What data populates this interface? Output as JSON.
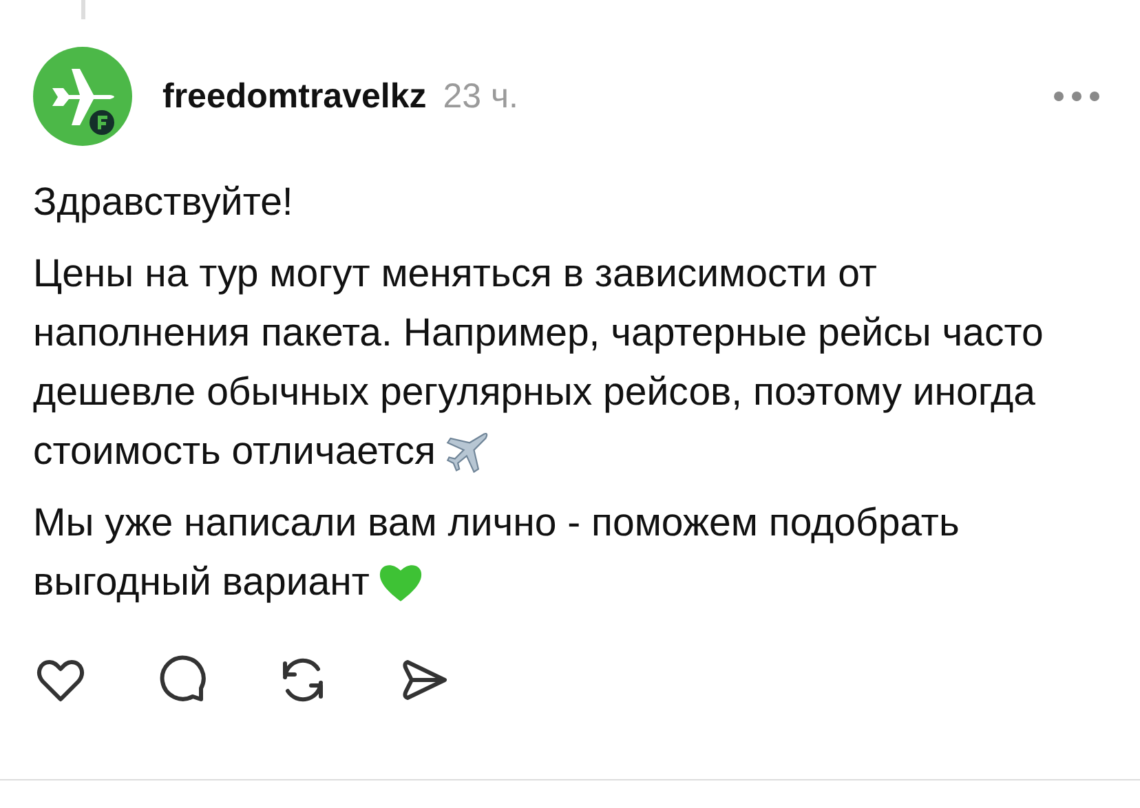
{
  "post": {
    "username": "freedomtravelkz",
    "time": "23 ч.",
    "paragraphs": [
      {
        "kind": "text",
        "text": "Здравствуйте!"
      },
      {
        "kind": "airplane",
        "text": "Цены на тур могут меняться в зависимости от наполнения пакета. Например, чартерные рейсы часто дешевле обычных регулярных рейсов, поэтому иногда стоимость отличается"
      },
      {
        "kind": "heart",
        "text": "Мы уже написали вам лично - поможем подобрать выгодный вариант"
      }
    ]
  }
}
